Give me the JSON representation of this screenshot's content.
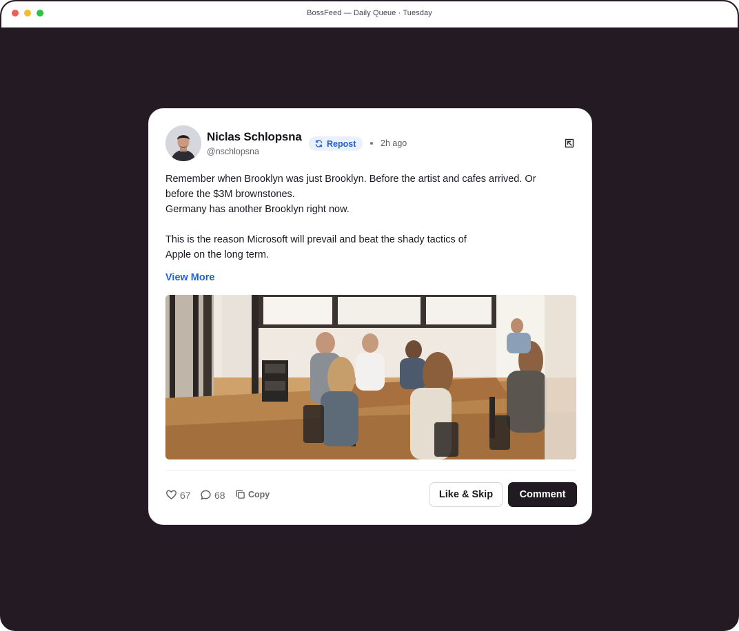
{
  "window": {
    "title": "BossFeed — Daily Queue · Tuesday"
  },
  "post": {
    "author_name": "Niclas Schlopsna",
    "author_handle": "@nschlopsna",
    "badge": "Repost",
    "timestamp": "2h ago",
    "paragraphs": [
      "Remember when Brooklyn was just Brooklyn. Before the artist and cafes arrived. Or before the $3M brownstones.\nGermany has another Brooklyn right now.",
      "This is the reason Microsoft will prevail and beat the shady tactics of\nApple on the long term."
    ],
    "view_more_label": "View More",
    "image_description_icon": "photo-office-meeting"
  },
  "actions": {
    "likes": "67",
    "comments": "68",
    "copy_label": "Copy",
    "like_skip_label": "Like & Skip",
    "comment_label": "Comment"
  },
  "colors": {
    "accent": "#1f5fd6",
    "backdrop": "#231a24",
    "primary_button": "#211a22",
    "badge_bg": "#eaf1fd"
  },
  "icons": {
    "repost": "repost-icon",
    "open": "open-external-icon",
    "like": "heart-icon",
    "comment": "comment-bubble-icon",
    "copy": "copy-icon"
  }
}
